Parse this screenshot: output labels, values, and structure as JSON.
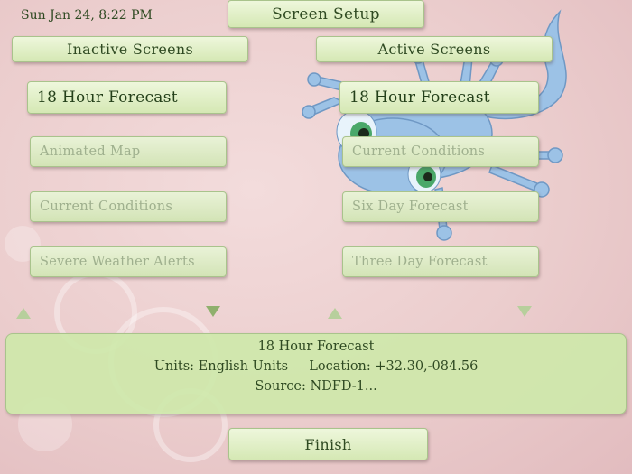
{
  "header": {
    "datetime": "Sun Jan 24, 8:22 PM",
    "title": "Screen Setup"
  },
  "inactive": {
    "heading": "Inactive Screens",
    "items": [
      {
        "label": "18 Hour Forecast"
      },
      {
        "label": "Animated Map"
      },
      {
        "label": "Current Conditions"
      },
      {
        "label": "Severe Weather Alerts"
      }
    ]
  },
  "active": {
    "heading": "Active Screens",
    "items": [
      {
        "label": "18 Hour Forecast"
      },
      {
        "label": "Current Conditions"
      },
      {
        "label": "Six Day Forecast"
      },
      {
        "label": "Three Day Forecast"
      }
    ]
  },
  "info": {
    "title": "18 Hour Forecast",
    "units_label": "Units:",
    "units_value": "English Units",
    "location_label": "Location:",
    "location_value": "+32.30,-084.56",
    "source_label": "Source:",
    "source_value": "NDFD-1..."
  },
  "finish_label": "Finish",
  "colors": {
    "button_fill": "#d5e8b4",
    "button_text": "#2f4a22",
    "background": "#ebcdcd",
    "panel_fill": "#cee8aa"
  }
}
